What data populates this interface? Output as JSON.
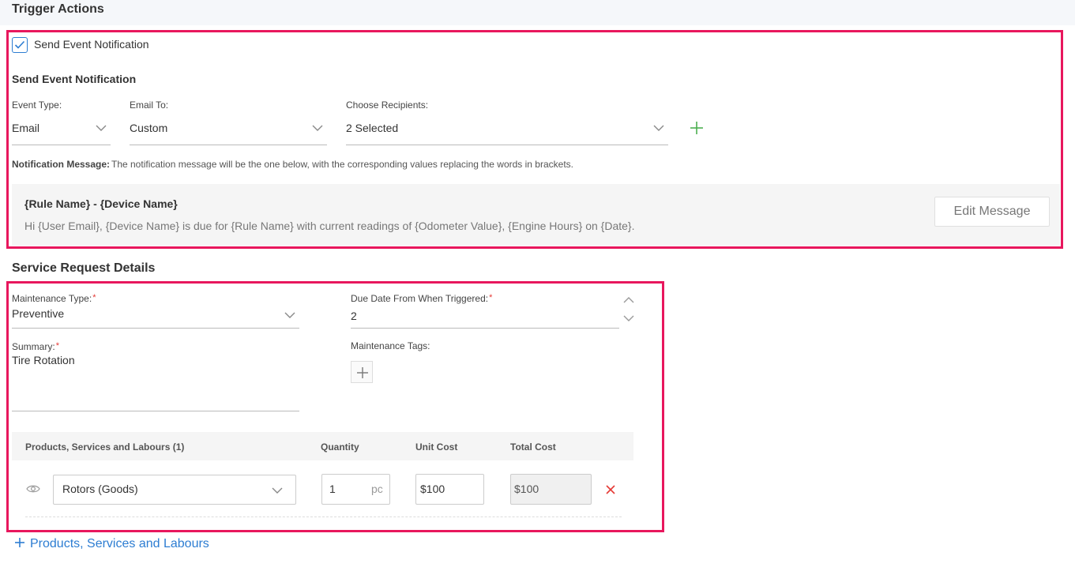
{
  "trigger_actions": {
    "title": "Trigger Actions",
    "checkbox_label": "Send Event Notification",
    "checked": true,
    "notification": {
      "heading": "Send Event Notification",
      "event_type": {
        "label": "Event Type:",
        "value": "Email"
      },
      "email_to": {
        "label": "Email To:",
        "value": "Custom"
      },
      "recipients": {
        "label": "Choose Recipients:",
        "value": "2 Selected"
      },
      "message_label": "Notification Message:",
      "message_hint": "The notification message will be the one below, with the corresponding values replacing the words in brackets.",
      "message_subject": "{Rule Name} - {Device Name}",
      "message_body": "Hi {User Email}, {Device Name} is due for {Rule Name} with current readings of {Odometer Value}, {Engine Hours} on {Date}.",
      "edit_button": "Edit Message"
    }
  },
  "service_request": {
    "title": "Service Request Details",
    "maintenance_type": {
      "label": "Maintenance Type:",
      "required": "*",
      "value": "Preventive"
    },
    "due_date": {
      "label": "Due Date From When Triggered:",
      "required": "*",
      "value": "2"
    },
    "summary": {
      "label": "Summary:",
      "required": "*",
      "value": "Tire Rotation"
    },
    "tags": {
      "label": "Maintenance Tags:"
    },
    "table": {
      "headers": [
        "Products, Services and Labours (1)",
        "Quantity",
        "Unit Cost",
        "Total Cost"
      ],
      "rows": [
        {
          "product": "Rotors (Goods)",
          "quantity": "1",
          "unit": "pc",
          "unit_cost": "$100",
          "total_cost": "$100"
        }
      ]
    },
    "add_link": "Products, Services and Labours"
  },
  "colors": {
    "highlight": "#e8175d",
    "accent": "#2d7dd2",
    "add": "#4caf50",
    "delete": "#e53935"
  }
}
